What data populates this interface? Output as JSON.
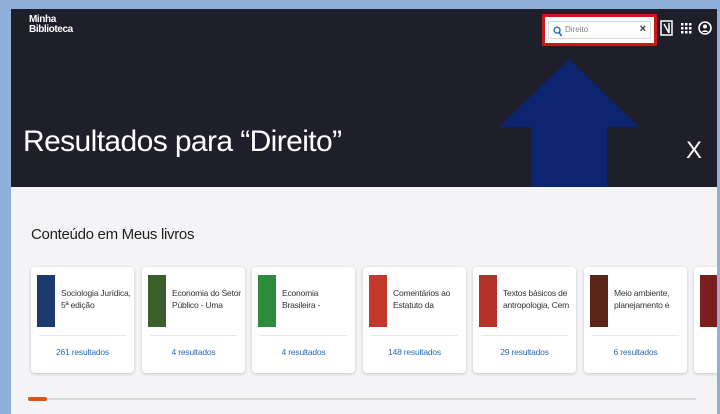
{
  "app": {
    "logo_line1": "Minha",
    "logo_line2": "Biblioteca"
  },
  "search": {
    "value": "Direito"
  },
  "page": {
    "title": "Resultados para “Direito”"
  },
  "section": {
    "title": "Conteúdo em Meus livros"
  },
  "cards": [
    {
      "title": "Sociologia Jurídica, 5ª edição",
      "results": "261 resultados",
      "cover_color": "#1d3a6e"
    },
    {
      "title": "Economia do Setor Público - Uma Abor...",
      "results": "4 resultados",
      "cover_color": "#3a5f2a"
    },
    {
      "title": "Economia Brasileira - Fundamentos e Atu...",
      "results": "4 resultados",
      "cover_color": "#2e8b3e"
    },
    {
      "title": "Comentários ao Estatuto da Criança...",
      "results": "148 resultados",
      "cover_color": "#c0392b"
    },
    {
      "title": "Textos básicos de antropologia, Cem a...",
      "results": "29 resultados",
      "cover_color": "#b5322a"
    },
    {
      "title": "Meio ambiente, planejamento e des...",
      "results": "6 resultados",
      "cover_color": "#5a2418"
    },
    {
      "title": "",
      "results": "",
      "cover_color": "#7a1e1e"
    }
  ],
  "colors": {
    "header_bg": "#1f1e2b",
    "highlight": "#d0141e",
    "arrow": "#0d2470",
    "link": "#2a6bb5",
    "scroll_thumb": "#d4561e"
  },
  "icons": [
    "search-icon",
    "clear-icon",
    "notebook-icon",
    "apps-grid-icon",
    "user-account-icon",
    "close-icon"
  ]
}
